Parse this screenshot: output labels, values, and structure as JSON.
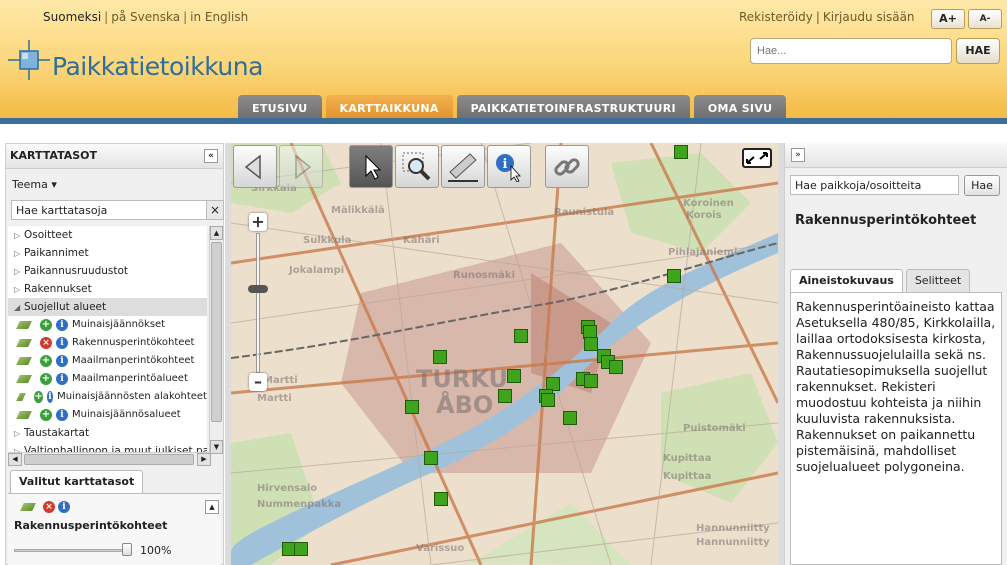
{
  "header": {
    "languages": [
      "Suomeksi",
      "på Svenska",
      "in English"
    ],
    "auth": {
      "register": "Rekisteröidy",
      "login": "Kirjaudu sisään"
    },
    "font_bigger": "A+",
    "font_smaller": "A-",
    "logo_text": "Paikkatietoikkuna",
    "search_placeholder": "Hae...",
    "search_button": "HAE"
  },
  "nav_tabs": [
    {
      "label": "ETUSIVU",
      "active": false
    },
    {
      "label": "KARTTAIKKUNA",
      "active": true
    },
    {
      "label": "PAIKKATIETOINFRASTRUKTUURI",
      "active": false
    },
    {
      "label": "OMA SIVU",
      "active": false
    }
  ],
  "left_panel": {
    "title": "KARTTATASOT",
    "collapse_icon": "«",
    "theme_dropdown": "Teema ▾",
    "layer_search_value": "Hae karttatasoja",
    "clear_icon": "×",
    "tree": [
      {
        "label": "Osoitteet",
        "open": false
      },
      {
        "label": "Paikannimet",
        "open": false
      },
      {
        "label": "Paikannusruudustot",
        "open": false
      },
      {
        "label": "Rakennukset",
        "open": false
      },
      {
        "label": "Suojellut alueet",
        "open": true
      }
    ],
    "sub_layers": [
      {
        "label": "Muinaisjäännökset",
        "selected": false
      },
      {
        "label": "Rakennusperintökohteet",
        "selected": true
      },
      {
        "label": "Maailmanperintökohteet",
        "selected": false
      },
      {
        "label": "Maailmanperintöalueet",
        "selected": false
      },
      {
        "label": "Muinaisjäännösten alakohteet",
        "selected": false
      },
      {
        "label": "Muinaisjäännösalueet",
        "selected": false
      }
    ],
    "tree_after": [
      {
        "label": "Taustakartat"
      },
      {
        "label": "Valtionhallinnon ja muut julkiset palvelut"
      }
    ],
    "selected_tab": "Valitut karttatasot",
    "selected_layer": "Rakennusperintökohteet",
    "opacity": "100%"
  },
  "map": {
    "labels": [
      "TURKU",
      "ÅBO",
      "Raunistula",
      "Koroinen",
      "Korois",
      "Sulkkula",
      "Kähäri",
      "Pihlajaniemi",
      "Jokalampi",
      "Martti",
      "Martti",
      "Kupittaa",
      "Kupittaa",
      "Hirvensalo",
      "Nummenpakka",
      "Varissuo",
      "Hannunniitty",
      "Hannunniitty",
      "Mälikkälä",
      "Runosmäki",
      "Puistomäki",
      "Sirkkala"
    ]
  },
  "right_panel": {
    "expand_icon": "»",
    "place_search_value": "Hae paikkoja/osoitteita",
    "place_search_button": "Hae",
    "info_title": "Rakennusperintökohteet",
    "tabs": [
      "Aineistokuvaus",
      "Selitteet"
    ],
    "description": "Rakennusperintöaineisto kattaa Asetuksella 480/85, Kirkkolailla, laillaa ortodoksisesta kirkosta, Rakennussuojelulailla sekä ns. Rautatiesopimuksella suojellut rakennukset. Rekisteri muodostuu kohteista ja niihin kuuluvista rakennuksista. Rakennukset on paikannettu pistemäisinä, mahdolliset suojelualueet polygoneina."
  },
  "colors": {
    "accent": "#e2922a",
    "brand_blue": "#3b6e98",
    "marker_green": "#3fa41c"
  }
}
